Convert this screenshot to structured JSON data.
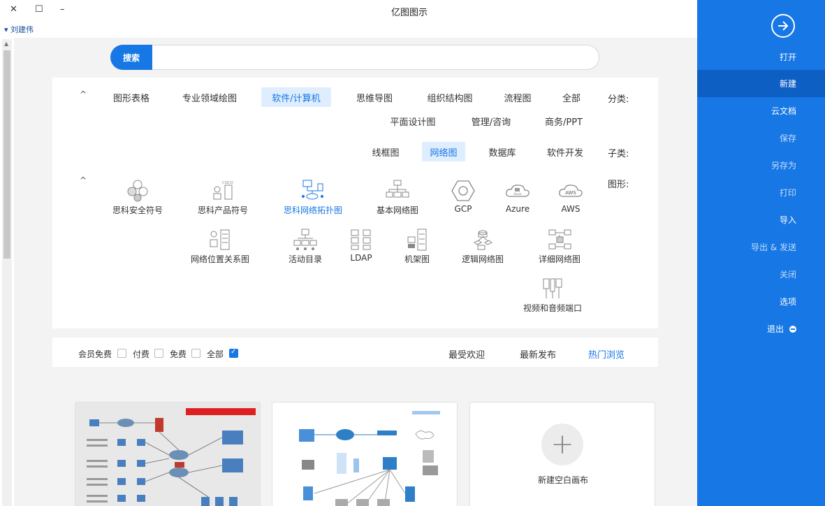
{
  "window": {
    "title": "亿图图示",
    "close": "✕",
    "maximize": "☐",
    "minimize": "–",
    "user": "▾ 刘建伟"
  },
  "sidebar": {
    "items": [
      {
        "label": "打开"
      },
      {
        "label": "新建"
      },
      {
        "label": "云文档"
      },
      {
        "label": "保存"
      },
      {
        "label": "另存为"
      },
      {
        "label": "打印"
      },
      {
        "label": "导入"
      },
      {
        "label": "导出 & 发送"
      },
      {
        "label": "关闭"
      },
      {
        "label": "选项"
      },
      {
        "label": "退出"
      }
    ]
  },
  "search": {
    "button": "搜索",
    "placeholder": ""
  },
  "categories": {
    "label": "分类:",
    "row1": [
      "全部",
      "流程图",
      "组织结构图",
      "思维导图",
      "软件/计算机",
      "专业领域绘图",
      "图形表格"
    ],
    "row2": [
      "商务/PPT",
      "管理/咨询",
      "平面设计图"
    ],
    "caret": "^"
  },
  "subcategories": {
    "label": "子类:",
    "items": [
      "软件开发",
      "数据库",
      "网络图",
      "线框图"
    ]
  },
  "shapes": {
    "label": "图形:",
    "caret": "^",
    "items": [
      "AWS",
      "Azure",
      "GCP",
      "基本网络图",
      "思科网络拓扑图",
      "思科产品符号",
      "思科安全符号",
      "详细网络图",
      "逻辑网络图",
      "机架图",
      "LDAP",
      "活动目录",
      "网络位置关系图",
      "视频和音频端口"
    ],
    "icon_texts": {
      "aws": "AWS",
      "azure": "Azure",
      "cisco": "CISCO"
    }
  },
  "filter": {
    "tabs": [
      "热门浏览",
      "最新发布",
      "最受欢迎"
    ],
    "options": [
      {
        "label": "全部",
        "checked": true
      },
      {
        "label": "免费",
        "checked": false
      },
      {
        "label": "付费",
        "checked": false
      },
      {
        "label": "会员免费",
        "checked": false
      }
    ]
  },
  "cards": {
    "new_blank": "新建空白画布",
    "plus": "+"
  },
  "colors": {
    "accent": "#1677e5",
    "sidebar_active": "#0e5fc4",
    "selected_chip_bg": "#dfeeff"
  }
}
